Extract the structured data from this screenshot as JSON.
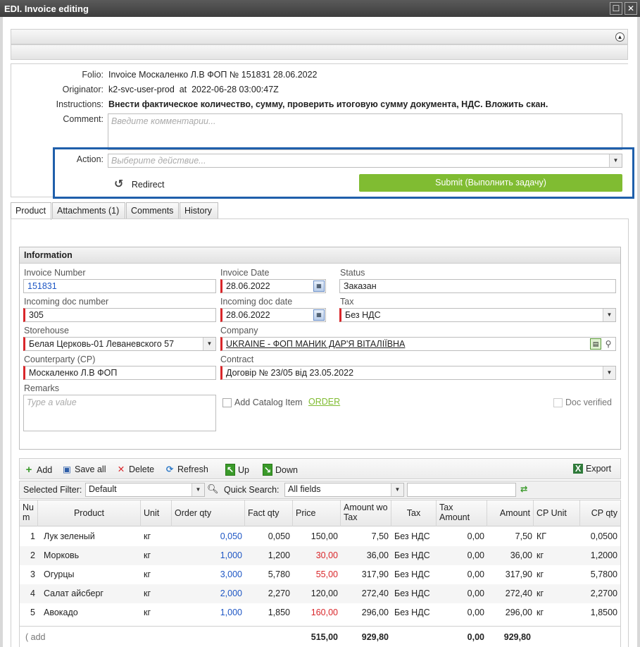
{
  "window": {
    "title": "EDI. Invoice editing"
  },
  "task": {
    "folio_label": "Folio:",
    "folio_value": "Invoice Москаленко Л.В ФОП № 151831 28.06.2022",
    "originator_label": "Originator:",
    "originator_value": "k2-svc-user-prod  at  2022-06-28 03:00:47Z",
    "instructions_label": "Instructions:",
    "instructions_value": "Внести фактическое количество, сумму, проверить итоговую сумму документа, НДС. Вложить скан.",
    "comment_label": "Comment:",
    "comment_placeholder": "Введите комментарии...",
    "action_label": "Action:",
    "action_placeholder": "Выберите действие...",
    "redirect_label": "Redirect",
    "submit_label": "Submit (Выполнить задачу)",
    "accent_color": "#80bc32",
    "highlight_color": "#1f5fab"
  },
  "tabs": [
    {
      "label": "Product",
      "active": true
    },
    {
      "label": "Attachments (1)",
      "active": false
    },
    {
      "label": "Comments",
      "active": false
    },
    {
      "label": "History",
      "active": false
    }
  ],
  "info": {
    "section_title": "Information",
    "invoice_number_label": "Invoice Number",
    "invoice_number": "151831",
    "invoice_date_label": "Invoice Date",
    "invoice_date": "28.06.2022",
    "status_label": "Status",
    "status": "Заказан",
    "incoming_doc_number_label": "Incoming doc number",
    "incoming_doc_number": "305",
    "incoming_doc_date_label": "Incoming doc date",
    "incoming_doc_date": "28.06.2022",
    "tax_label": "Tax",
    "tax": "Без НДС",
    "storehouse_label": "Storehouse",
    "storehouse": "Белая Церковь-01 Леваневского 57",
    "company_label": "Company",
    "company": "UKRAINE - ФОП МАНИК ДАР'Я ВІТАЛІЇВНА",
    "counterparty_label": "Counterparty (CP)",
    "counterparty": "Москаленко Л.В ФОП",
    "contract_label": "Contract",
    "contract": "Договір № 23/05 від 23.05.2022",
    "remarks_label": "Remarks",
    "remarks_placeholder": "Type a value",
    "add_catalog_label": "Add Catalog Item",
    "order_link": "ORDER",
    "doc_verified_label": "Doc verified"
  },
  "toolbar": {
    "add": "Add",
    "save_all": "Save all",
    "delete": "Delete",
    "refresh": "Refresh",
    "up": "Up",
    "down": "Down",
    "export": "Export"
  },
  "filter": {
    "selected_filter_label": "Selected Filter:",
    "selected_filter_value": "Default",
    "quick_search_label": "Quick Search:",
    "quick_search_field": "All fields",
    "quick_search_value": ""
  },
  "grid": {
    "headers": {
      "num": "Nu m",
      "product": "Product",
      "unit": "Unit",
      "order_qty": "Order qty",
      "fact_qty": "Fact qty",
      "price": "Price",
      "amount_wo_tax": "Amount wo Tax",
      "tax": "Tax",
      "tax_amount": "Tax Amount",
      "amount": "Amount",
      "cp_unit": "CP Unit",
      "cp_qty": "CP qty"
    },
    "rows": [
      {
        "num": "1",
        "product": "Лук зеленый",
        "unit": "кг",
        "order_qty": "0,050",
        "fact_qty": "0,050",
        "price": "150,00",
        "price_red": false,
        "amount_wo_tax": "7,50",
        "tax": "Без НДС",
        "tax_amount": "0,00",
        "amount": "7,50",
        "cp_unit": "КГ",
        "cp_qty": "0,0500"
      },
      {
        "num": "2",
        "product": "Морковь",
        "unit": "кг",
        "order_qty": "1,000",
        "fact_qty": "1,200",
        "price": "30,00",
        "price_red": true,
        "amount_wo_tax": "36,00",
        "tax": "Без НДС",
        "tax_amount": "0,00",
        "amount": "36,00",
        "cp_unit": "кг",
        "cp_qty": "1,2000"
      },
      {
        "num": "3",
        "product": "Огурцы",
        "unit": "кг",
        "order_qty": "3,000",
        "fact_qty": "5,780",
        "price": "55,00",
        "price_red": true,
        "amount_wo_tax": "317,90",
        "tax": "Без НДС",
        "tax_amount": "0,00",
        "amount": "317,90",
        "cp_unit": "кг",
        "cp_qty": "5,7800"
      },
      {
        "num": "4",
        "product": "Салат айсберг",
        "unit": "кг",
        "order_qty": "2,000",
        "fact_qty": "2,270",
        "price": "120,00",
        "price_red": false,
        "amount_wo_tax": "272,40",
        "tax": "Без НДС",
        "tax_amount": "0,00",
        "amount": "272,40",
        "cp_unit": "кг",
        "cp_qty": "2,2700"
      },
      {
        "num": "5",
        "product": "Авокадо",
        "unit": "кг",
        "order_qty": "1,000",
        "fact_qty": "1,850",
        "price": "160,00",
        "price_red": true,
        "amount_wo_tax": "296,00",
        "tax": "Без НДС",
        "tax_amount": "0,00",
        "amount": "296,00",
        "cp_unit": "кг",
        "cp_qty": "1,8500"
      }
    ],
    "footer": {
      "add": "( add",
      "price_total": "515,00",
      "amount_wo_tax_total": "929,80",
      "tax_amount_total": "0,00",
      "amount_total": "929,80"
    }
  }
}
